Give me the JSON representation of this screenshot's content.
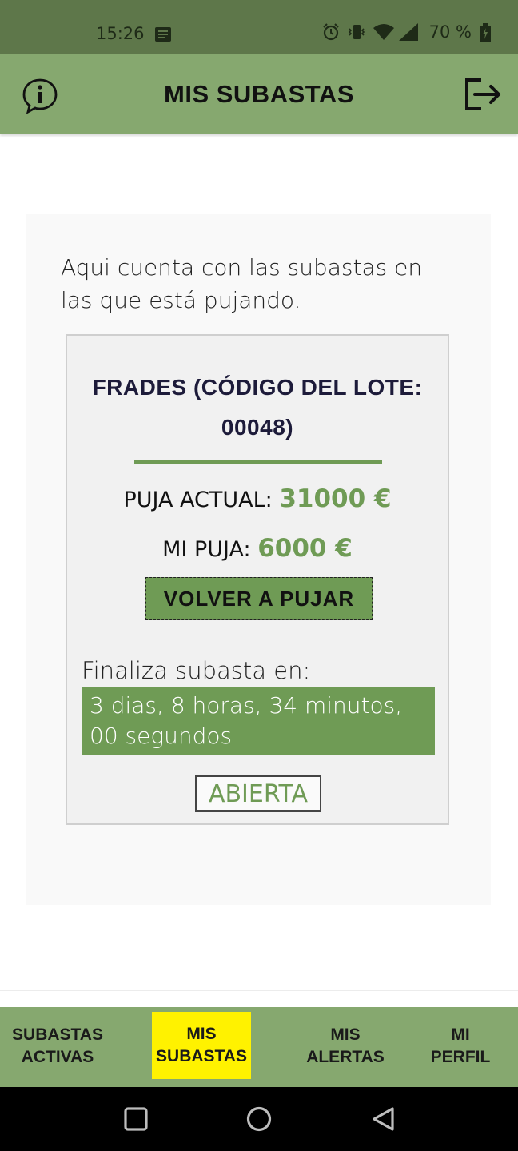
{
  "status_bar": {
    "time": "15:26",
    "battery": "70 %"
  },
  "header": {
    "title": "MIS SUBASTAS"
  },
  "intro": "Aqui cuenta con las subastas en las que está pujando.",
  "auction": {
    "title": "FRADES (CÓDIGO DEL LOTE: 00048)",
    "current_bid_label": "PUJA ACTUAL:",
    "current_bid_value": "31000 €",
    "my_bid_label": "MI PUJA:",
    "my_bid_value": "6000 €",
    "rebid_label": "VOLVER A PUJAR",
    "ends_label": "Finaliza subasta en:",
    "countdown": "3 dias, 8 horas, 34 minutos, 00 segundos",
    "status": "ABIERTA"
  },
  "bottom_nav": {
    "items": [
      {
        "label_line1": "SUBASTAS",
        "label_line2": "ACTIVAS"
      },
      {
        "label_line1": "MIS",
        "label_line2": "SUBASTAS"
      },
      {
        "label_line1": "MIS",
        "label_line2": "ALERTAS"
      },
      {
        "label_line1": "MI",
        "label_line2": "PERFIL"
      }
    ],
    "active_index": 1
  },
  "colors": {
    "status_bar": "#5e774a",
    "app_bar": "#86a86f",
    "accent_green": "#6f9b55",
    "active_tab": "#fff200"
  },
  "icons": [
    "info-icon",
    "logout-icon",
    "alarm-icon",
    "vibrate-icon",
    "wifi-icon",
    "signal-icon",
    "battery-icon",
    "notification-icon",
    "square-nav-icon",
    "circle-nav-icon",
    "back-triangle-icon"
  ]
}
